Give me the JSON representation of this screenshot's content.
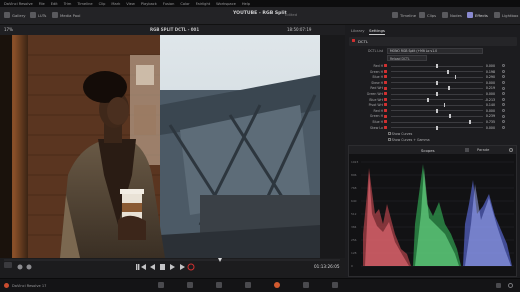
{
  "menubar": {
    "items": [
      "DaVinci Resolve",
      "File",
      "Edit",
      "Trim",
      "Timeline",
      "Clip",
      "Mark",
      "View",
      "Playback",
      "Fusion",
      "Color",
      "Fairlight",
      "Workspace",
      "Help"
    ]
  },
  "toolbar": {
    "left": [
      {
        "label": "Gallery",
        "icon": "gallery-icon"
      },
      {
        "label": "LUTs",
        "icon": "lut-icon"
      },
      {
        "label": "Media Pool",
        "icon": "media-pool-icon"
      }
    ],
    "project_title": "YOUTUBE - RGB Split",
    "project_status": "Edited",
    "right": [
      {
        "label": "Timeline",
        "icon": "timeline-icon"
      },
      {
        "label": "Clips",
        "icon": "clips-icon"
      },
      {
        "label": "Nodes",
        "icon": "nodes-icon"
      },
      {
        "label": "Effects",
        "icon": "effects-icon"
      },
      {
        "label": "Lightbox",
        "icon": "lightbox-icon"
      }
    ]
  },
  "viewer": {
    "zoom": "17%",
    "clip_name": "RGB SPLIT DCTL - 001",
    "timecode": "18:50:07:19",
    "overlay_text": "ON"
  },
  "transport": {
    "timecode": "01:13:26:05"
  },
  "side": {
    "tabs": [
      "Library",
      "Settings"
    ],
    "active_tab": "Settings",
    "section": "DCTL",
    "dctl_label": "DCTL List",
    "dctl_value": "MONO RGB Split (+Mlt Lo v1.0",
    "reload_label": "Reload DCTL",
    "params": [
      {
        "label": "Red H",
        "value": "0.000",
        "knob": 0.5
      },
      {
        "label": "Green H",
        "value": "0.198",
        "knob": 0.62
      },
      {
        "label": "Blue H",
        "value": "0.290",
        "knob": 0.7
      },
      {
        "label": "Skew H",
        "value": "0.000",
        "knob": 0.5
      },
      {
        "label": "Red Wrt",
        "value": "0.219",
        "knob": 0.63
      },
      {
        "label": "Green Wrt",
        "value": "0.000",
        "knob": 0.5
      },
      {
        "label": "Blue Wrt",
        "value": "-0.213",
        "knob": 0.4
      },
      {
        "label": "Pivot Wrt",
        "value": "0.140",
        "knob": 0.58
      },
      {
        "label": "Red H",
        "value": "0.000",
        "knob": 0.5
      },
      {
        "label": "Green H",
        "value": "0.239",
        "knob": 0.64
      },
      {
        "label": "Blue H",
        "value": "0.735",
        "knob": 0.86
      },
      {
        "label": "Skew Lo",
        "value": "0.000",
        "knob": 0.5
      }
    ],
    "show_curves": "Show Curves",
    "show_curves_gamma": "Show Curves + Gamma"
  },
  "scopes": {
    "title": "Scopes",
    "mode": "Parade",
    "graticule": [
      "1023",
      "896",
      "768",
      "640",
      "512",
      "384",
      "256",
      "128",
      "0"
    ]
  },
  "footer": {
    "app_name": "DaVinci Resolve 17"
  },
  "colors": {
    "accent_red": "#d23030",
    "parade_red": "#e0505a",
    "parade_green": "#38c860",
    "parade_blue": "#6a7cff"
  }
}
